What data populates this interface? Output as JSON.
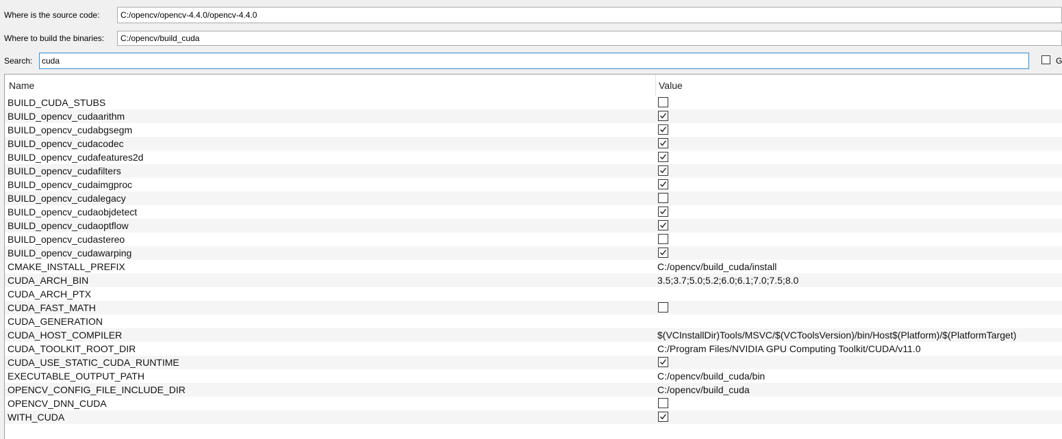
{
  "source": {
    "label": "Where is the source code:",
    "value": "C:/opencv/opencv-4.4.0/opencv-4.4.0"
  },
  "build": {
    "label": "Where to build the binaries:",
    "value": "C:/opencv/build_cuda"
  },
  "search": {
    "label": "Search:",
    "value": "cuda"
  },
  "grouped": {
    "label": "G",
    "checked": false
  },
  "table": {
    "headers": {
      "name": "Name",
      "value": "Value"
    },
    "rows": [
      {
        "name": "BUILD_CUDA_STUBS",
        "type": "bool",
        "checked": false
      },
      {
        "name": "BUILD_opencv_cudaarithm",
        "type": "bool",
        "checked": true
      },
      {
        "name": "BUILD_opencv_cudabgsegm",
        "type": "bool",
        "checked": true
      },
      {
        "name": "BUILD_opencv_cudacodec",
        "type": "bool",
        "checked": true
      },
      {
        "name": "BUILD_opencv_cudafeatures2d",
        "type": "bool",
        "checked": true
      },
      {
        "name": "BUILD_opencv_cudafilters",
        "type": "bool",
        "checked": true
      },
      {
        "name": "BUILD_opencv_cudaimgproc",
        "type": "bool",
        "checked": true
      },
      {
        "name": "BUILD_opencv_cudalegacy",
        "type": "bool",
        "checked": false
      },
      {
        "name": "BUILD_opencv_cudaobjdetect",
        "type": "bool",
        "checked": true
      },
      {
        "name": "BUILD_opencv_cudaoptflow",
        "type": "bool",
        "checked": true
      },
      {
        "name": "BUILD_opencv_cudastereo",
        "type": "bool",
        "checked": false
      },
      {
        "name": "BUILD_opencv_cudawarping",
        "type": "bool",
        "checked": true
      },
      {
        "name": "CMAKE_INSTALL_PREFIX",
        "type": "text",
        "value": "C:/opencv/build_cuda/install"
      },
      {
        "name": "CUDA_ARCH_BIN",
        "type": "text",
        "value": "3.5;3.7;5.0;5.2;6.0;6.1;7.0;7.5;8.0"
      },
      {
        "name": "CUDA_ARCH_PTX",
        "type": "text",
        "value": ""
      },
      {
        "name": "CUDA_FAST_MATH",
        "type": "bool",
        "checked": false
      },
      {
        "name": "CUDA_GENERATION",
        "type": "text",
        "value": ""
      },
      {
        "name": "CUDA_HOST_COMPILER",
        "type": "text",
        "value": "$(VCInstallDir)Tools/MSVC/$(VCToolsVersion)/bin/Host$(Platform)/$(PlatformTarget)"
      },
      {
        "name": "CUDA_TOOLKIT_ROOT_DIR",
        "type": "text",
        "value": "C:/Program Files/NVIDIA GPU Computing Toolkit/CUDA/v11.0"
      },
      {
        "name": "CUDA_USE_STATIC_CUDA_RUNTIME",
        "type": "bool",
        "checked": true
      },
      {
        "name": "EXECUTABLE_OUTPUT_PATH",
        "type": "text",
        "value": "C:/opencv/build_cuda/bin"
      },
      {
        "name": "OPENCV_CONFIG_FILE_INCLUDE_DIR",
        "type": "text",
        "value": "C:/opencv/build_cuda"
      },
      {
        "name": "OPENCV_DNN_CUDA",
        "type": "bool",
        "checked": false
      },
      {
        "name": "WITH_CUDA",
        "type": "bool",
        "checked": true
      }
    ]
  }
}
